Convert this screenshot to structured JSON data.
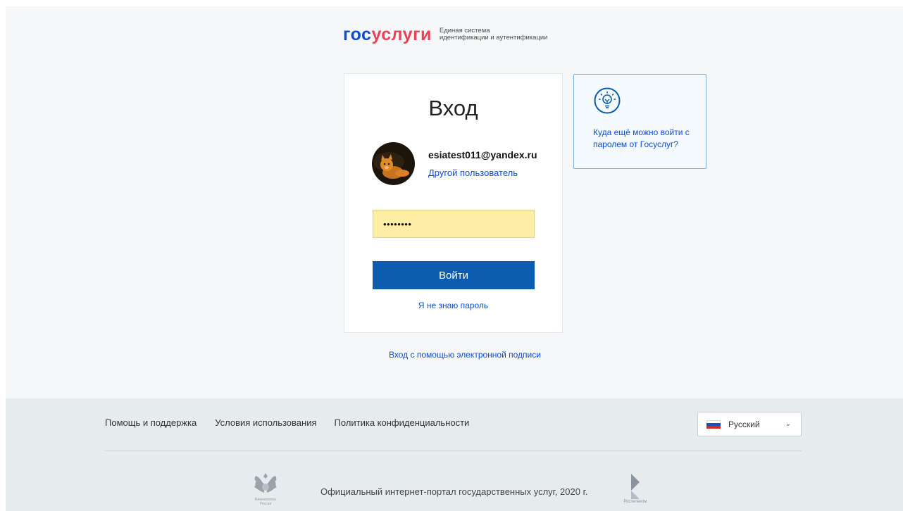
{
  "header": {
    "logo_part1": "гос",
    "logo_part2": "услуги",
    "subtitle_line1": "Единая система",
    "subtitle_line2": "идентификации и аутентификации"
  },
  "login_card": {
    "title": "Вход",
    "user_email": "esiatest011@yandex.ru",
    "other_user_link": "Другой пользователь",
    "password_value": "........",
    "login_button": "Войти",
    "forgot_password_link": "Я не знаю пароль"
  },
  "hint_card": {
    "icon": "lightbulb-icon",
    "text": "Куда ещё можно войти с паролем от Госуслуг?"
  },
  "eds_link": "Вход с помощью электронной подписи",
  "footer": {
    "links": [
      "Помощь и поддержка",
      "Условия использования",
      "Политика конфиденциальности"
    ],
    "language": "Русский",
    "copyright": "Официальный интернет-портал государственных услуг, 2020 г.",
    "ministry_logo_text_1": "Минкомсвязь",
    "ministry_logo_text_2": "России",
    "rostelecom_logo_text": "Ростелеком"
  },
  "colors": {
    "brand_blue": "#0d4cd3",
    "brand_red": "#ee3f58",
    "button_blue": "#0c5db0",
    "autofill_yellow": "#feeda4"
  }
}
